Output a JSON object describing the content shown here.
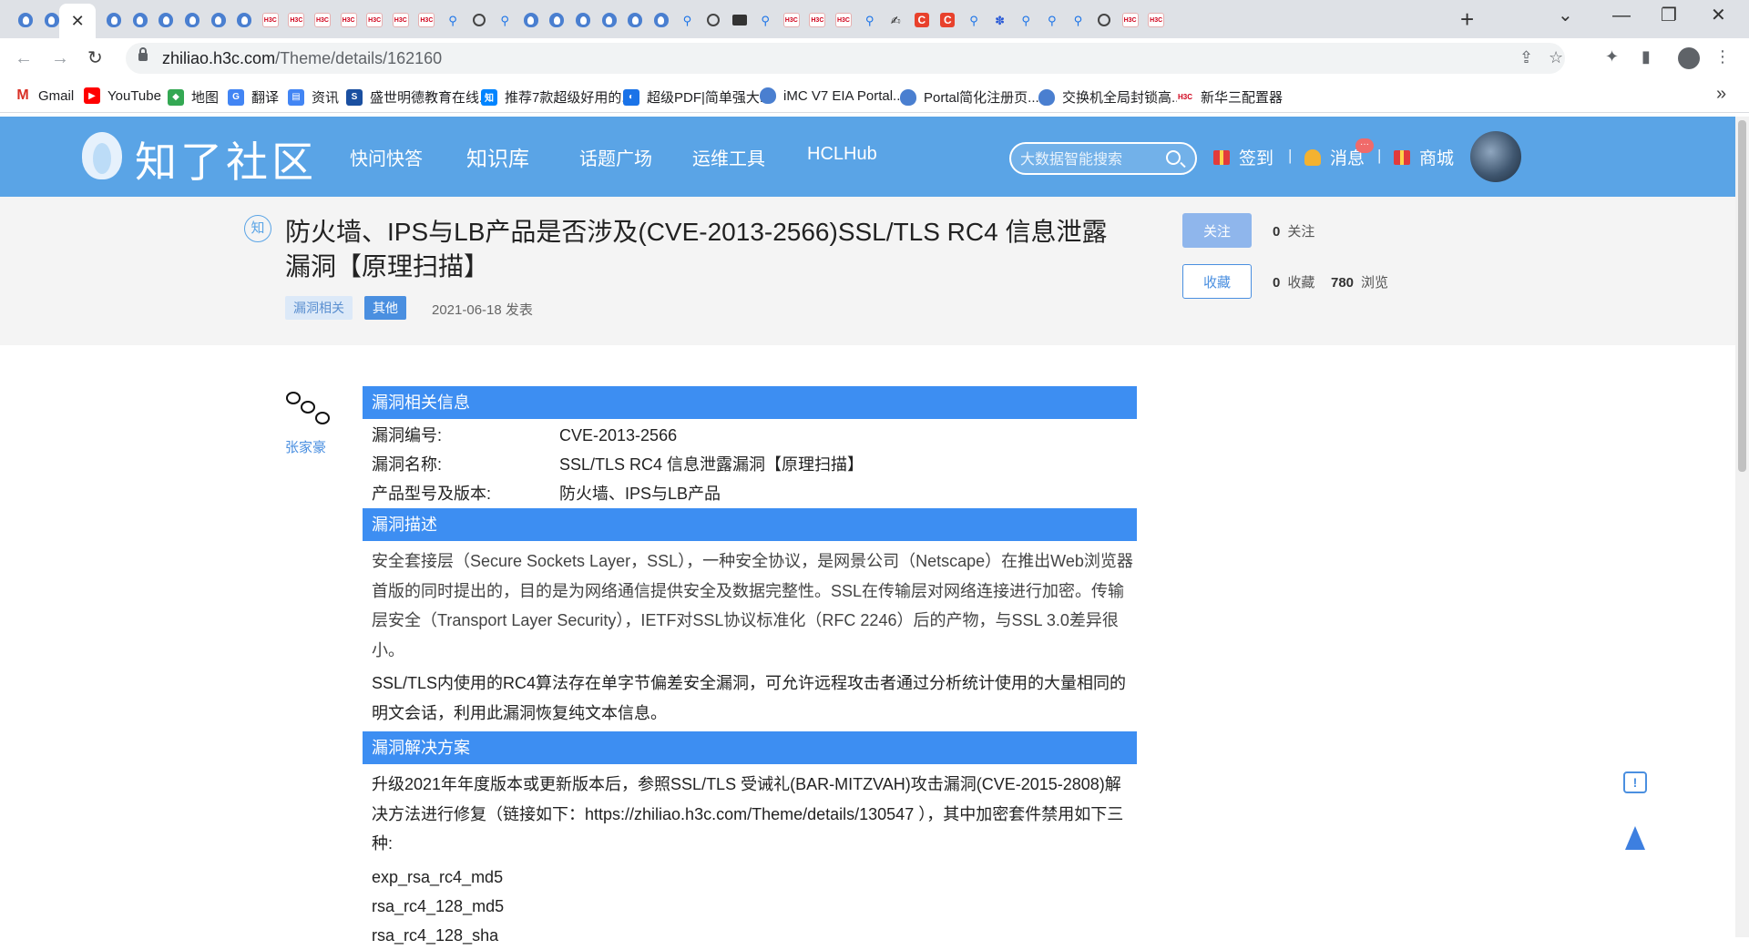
{
  "browser": {
    "tabs": [
      {
        "icon": "zhiliao-icon",
        "class": "fav-zl"
      },
      {
        "icon": "zhiliao-icon",
        "class": "fav-zl"
      },
      {
        "icon": "close-icon",
        "class": "tab-close",
        "active": true
      },
      {
        "icon": "zhiliao-icon",
        "class": "fav-zl"
      },
      {
        "icon": "zhiliao-icon",
        "class": "fav-zl"
      },
      {
        "icon": "zhiliao-icon",
        "class": "fav-zl"
      },
      {
        "icon": "zhiliao-icon",
        "class": "fav-zl"
      },
      {
        "icon": "zhiliao-icon",
        "class": "fav-zl"
      },
      {
        "icon": "zhiliao-icon",
        "class": "fav-zl"
      },
      {
        "icon": "h3c-icon",
        "class": "fav-h3c"
      },
      {
        "icon": "h3c-icon",
        "class": "fav-h3c"
      },
      {
        "icon": "h3c-icon",
        "class": "fav-h3c"
      },
      {
        "icon": "h3c-icon",
        "class": "fav-h3c"
      },
      {
        "icon": "h3c-icon",
        "class": "fav-h3c"
      },
      {
        "icon": "h3c-icon",
        "class": "fav-h3c"
      },
      {
        "icon": "h3c-icon",
        "class": "fav-h3c"
      },
      {
        "icon": "search-icon",
        "class": "fav-search"
      },
      {
        "icon": "globe-icon",
        "class": "fav-globe"
      },
      {
        "icon": "search-icon",
        "class": "fav-search"
      },
      {
        "icon": "zhiliao-icon",
        "class": "fav-zl"
      },
      {
        "icon": "zhiliao-icon",
        "class": "fav-zl"
      },
      {
        "icon": "zhiliao-icon",
        "class": "fav-zl"
      },
      {
        "icon": "zhiliao-icon",
        "class": "fav-zl"
      },
      {
        "icon": "zhiliao-icon",
        "class": "fav-zl"
      },
      {
        "icon": "zhiliao-icon",
        "class": "fav-zl"
      },
      {
        "icon": "search-icon",
        "class": "fav-search"
      },
      {
        "icon": "globe-icon",
        "class": "fav-globe"
      },
      {
        "icon": "folder-icon",
        "class": "fav-folder"
      },
      {
        "icon": "search-icon",
        "class": "fav-search"
      },
      {
        "icon": "h3c-icon",
        "class": "fav-h3c"
      },
      {
        "icon": "h3c-icon",
        "class": "fav-h3c"
      },
      {
        "icon": "h3c-icon",
        "class": "fav-h3c"
      },
      {
        "icon": "search-icon",
        "class": "fav-search"
      },
      {
        "icon": "script-icon",
        "class": "fav-misc"
      },
      {
        "icon": "csdn-icon",
        "class": "fav-c"
      },
      {
        "icon": "csdn-icon",
        "class": "fav-c"
      },
      {
        "icon": "search-icon",
        "class": "fav-search"
      },
      {
        "icon": "baidu-paw-icon",
        "class": "fav-paw"
      },
      {
        "icon": "search-icon",
        "class": "fav-search"
      },
      {
        "icon": "search-icon",
        "class": "fav-search"
      },
      {
        "icon": "search-icon",
        "class": "fav-search"
      },
      {
        "icon": "globe-icon",
        "class": "fav-globe"
      },
      {
        "icon": "h3c-icon",
        "class": "fav-h3c"
      },
      {
        "icon": "h3c-icon",
        "class": "fav-h3c"
      }
    ],
    "url_host": "zhiliao.h3c.com",
    "url_path": "/Theme/details/162160",
    "bookmarks": [
      {
        "label": "Gmail",
        "icon": "gmail-icon",
        "color": "#d93025",
        "glyph": "M"
      },
      {
        "label": "YouTube",
        "icon": "youtube-icon",
        "color": "#ff0000",
        "glyph": "▶"
      },
      {
        "label": "地图",
        "icon": "maps-icon",
        "color": "#34a853",
        "glyph": "◆"
      },
      {
        "label": "翻译",
        "icon": "translate-icon",
        "color": "#4285f4",
        "glyph": "G"
      },
      {
        "label": "资讯",
        "icon": "news-icon",
        "color": "#4285f4",
        "glyph": "▤"
      },
      {
        "label": "盛世明德教育在线...",
        "icon": "shengshi-icon",
        "color": "#1a4fa0",
        "glyph": "S"
      },
      {
        "label": "推荐7款超级好用的...",
        "icon": "zhihu-icon",
        "color": "#0084ff",
        "glyph": "知"
      },
      {
        "label": "超级PDF|简单强大...",
        "icon": "pdf-icon",
        "color": "#1a73e8",
        "glyph": "◐"
      },
      {
        "label": "iMC V7 EIA Portal...",
        "icon": "zhiliao-icon",
        "color": "#4a7fd0",
        "glyph": ""
      },
      {
        "label": "Portal简化注册页...",
        "icon": "zhiliao-icon",
        "color": "#4a7fd0",
        "glyph": ""
      },
      {
        "label": "交换机全局封锁高...",
        "icon": "zhiliao-icon",
        "color": "#4a7fd0",
        "glyph": ""
      },
      {
        "label": "新华三配置器",
        "icon": "h3c-icon",
        "color": "#ffffff",
        "glyph": "H3C"
      }
    ]
  },
  "site": {
    "logo": "知了社区",
    "nav": [
      "快问快答",
      "知识库",
      "话题广场",
      "运维工具",
      "HCLHub"
    ],
    "search_placeholder": "大数据智能搜索",
    "checkin": "签到",
    "messages": "消息",
    "message_badge": "···",
    "shop": "商城",
    "separator": "|"
  },
  "article": {
    "badge": "知",
    "title": "防火墙、IPS与LB产品是否涉及(CVE-2013-2566)SSL/TLS RC4 信息泄露漏洞【原理扫描】",
    "tags": [
      "漏洞相关",
      "其他"
    ],
    "date": "2021-06-18 发表",
    "follow_btn": "关注",
    "fav_btn": "收藏",
    "follow_count": "0",
    "follow_label": "关注",
    "fav_count": "0",
    "fav_label": "收藏",
    "view_count": "780",
    "view_label": "浏览",
    "author": "张家豪",
    "sections": {
      "info_title": "漏洞相关信息",
      "info_rows": [
        {
          "k": "漏洞编号:",
          "v": "CVE-2013-2566"
        },
        {
          "k": "漏洞名称:",
          "v": "SSL/TLS RC4 信息泄露漏洞【原理扫描】"
        },
        {
          "k": "产品型号及版本:",
          "v": "防火墙、IPS与LB产品"
        }
      ],
      "desc_title": "漏洞描述",
      "desc_p1": "安全套接层（Secure Sockets Layer，SSL），一种安全协议，是网景公司（Netscape）在推出Web浏览器首版的同时提出的，目的是为网络通信提供安全及数据完整性。SSL在传输层对网络连接进行加密。传输层安全（Transport Layer Security），IETF对SSL协议标准化（RFC 2246）后的产物，与SSL 3.0差异很小。",
      "desc_p2": "SSL/TLS内使用的RC4算法存在单字节偏差安全漏洞，可允许远程攻击者通过分析统计使用的大量相同的明文会话，利用此漏洞恢复纯文本信息。",
      "fix_title": "漏洞解决方案",
      "fix_p1": "升级2021年年度版本或更新版本后，参照SSL/TLS 受诫礼(BAR-MITZVAH)攻击漏洞(CVE-2015-2808)解决方法进行修复（链接如下：https://zhiliao.h3c.com/Theme/details/130547 ），其中加密套件禁用如下三种:",
      "ciphers": [
        "exp_rsa_rc4_md5",
        "rsa_rc4_128_md5",
        "rsa_rc4_128_sha"
      ]
    }
  },
  "floating": {
    "feedback_glyph": "!"
  }
}
